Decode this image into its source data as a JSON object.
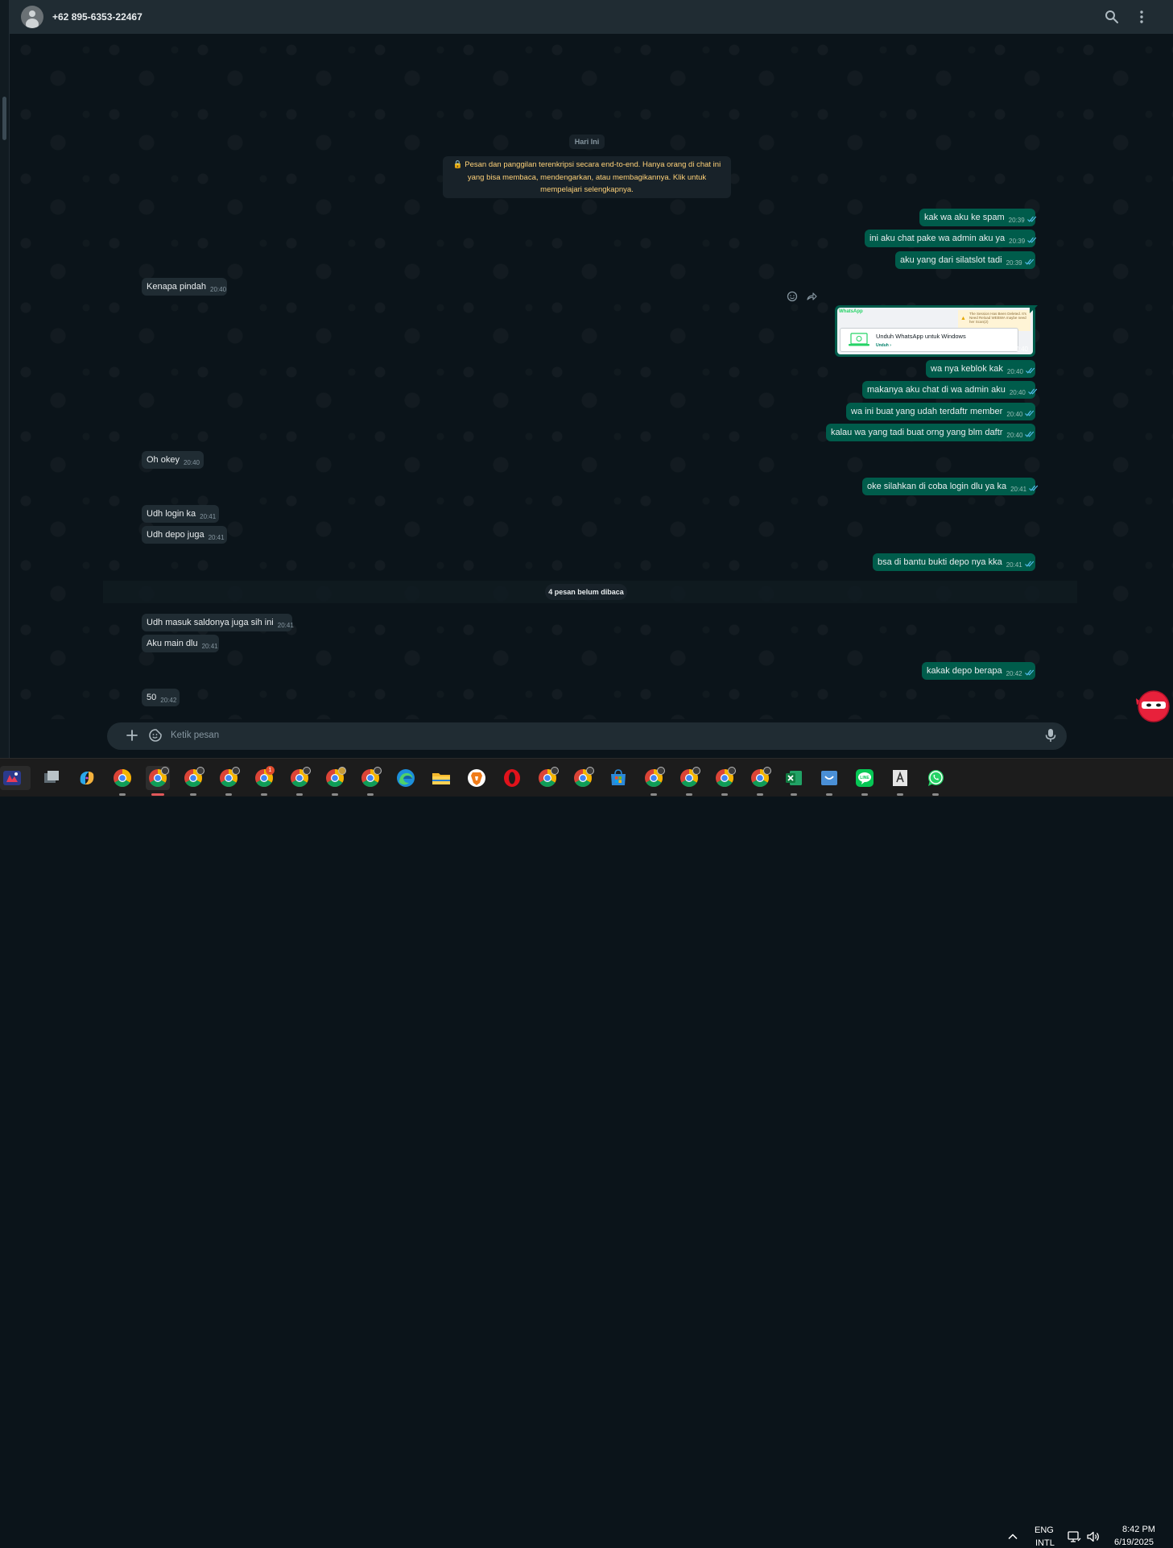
{
  "header": {
    "contact_name": "+62 895-6353-22467",
    "icons": [
      "person-avatar-icon",
      "search-icon",
      "more-vertical-icon"
    ]
  },
  "chat": {
    "date_label": "Hari Ini",
    "encryption_notice": "🔒 Pesan dan panggilan terenkripsi secara end-to-end. Hanya orang di chat ini yang bisa membaca, mendengarkan, atau membagikannya. Klik untuk mempelajari selengkapnya.",
    "unread_label": "4 pesan belum dibaca",
    "messages": [
      {
        "dir": "out",
        "text": "kak wa aku ke spam",
        "time": "20:39"
      },
      {
        "dir": "out",
        "text": "ini aku chat pake wa admin aku ya",
        "time": "20:39"
      },
      {
        "dir": "out",
        "text": "aku yang dari silatslot tadi",
        "time": "20:39"
      },
      {
        "dir": "in",
        "text": "Kenapa pindah",
        "time": "20:40"
      },
      {
        "dir": "out",
        "text": "wa nya keblok kak",
        "time": "20:40"
      },
      {
        "dir": "out",
        "text": "makanya aku chat di wa admin aku",
        "time": "20:40"
      },
      {
        "dir": "out",
        "text": "wa ini buat yang udah terdaftr member",
        "time": "20:40"
      },
      {
        "dir": "out",
        "text": "kalau wa yang tadi buat orng yang blm daftr",
        "time": "20:40"
      },
      {
        "dir": "in",
        "text": "Oh okey",
        "time": "20:40"
      },
      {
        "dir": "out",
        "text": "oke silahkan di coba login dlu ya ka",
        "time": "20:41"
      },
      {
        "dir": "in",
        "text": "Udh login ka",
        "time": "20:41"
      },
      {
        "dir": "in",
        "text": "Udh depo juga",
        "time": "20:41"
      },
      {
        "dir": "out",
        "text": "bsa di bantu bukti depo nya kka",
        "time": "20:41"
      },
      {
        "dir": "in",
        "text": "Udh masuk saldonya juga sih ini",
        "time": "20:41"
      },
      {
        "dir": "in",
        "text": "Aku main dlu",
        "time": "20:41"
      },
      {
        "dir": "out",
        "text": "kakak depo berapa",
        "time": "20:42"
      },
      {
        "dir": "in",
        "text": "50",
        "time": "20:42"
      }
    ],
    "image_message": {
      "brand": "WhatsApp",
      "warning": "The Session Has Been Deleted. It's Need Reload WEBWA maybe need her Scan(2)",
      "card_title": "Unduh WhatsApp untuk Windows",
      "card_link": "Unduh ›",
      "time": "20:40"
    },
    "hover_actions": [
      "react-emoji-icon",
      "forward-icon"
    ]
  },
  "composer": {
    "placeholder": "Ketik pesan",
    "icons": [
      "plus-icon",
      "sticker-icon",
      "microphone-icon"
    ]
  },
  "taskbar": {
    "apps": [
      "start-icon",
      "task-view-icon",
      "copilot-icon",
      "chrome-icon",
      "chrome-icon",
      "chrome-icon",
      "chrome-icon",
      "chrome-icon",
      "chrome-icon",
      "chrome-icon",
      "chrome-icon",
      "edge-icon",
      "file-explorer-icon",
      "brave-icon",
      "opera-icon",
      "chrome-icon",
      "chrome-icon",
      "microsoft-store-icon",
      "chrome-icon",
      "chrome-icon",
      "chrome-icon",
      "chrome-icon",
      "excel-icon",
      "screenshot-icon",
      "line-icon",
      "font-viewer-icon",
      "whatsapp-icon"
    ],
    "notification_badge": "1",
    "lang_top": "ENG",
    "lang_bottom": "INTL",
    "time": "8:42 PM",
    "date": "6/19/2025"
  },
  "colors": {
    "outgoing_bubble": "#005c4b",
    "incoming_bubble": "#202c33",
    "chat_background": "#0b141a",
    "header": "#202c33",
    "read_ticks": "#53bdeb",
    "encryption_text": "#ffd279"
  }
}
